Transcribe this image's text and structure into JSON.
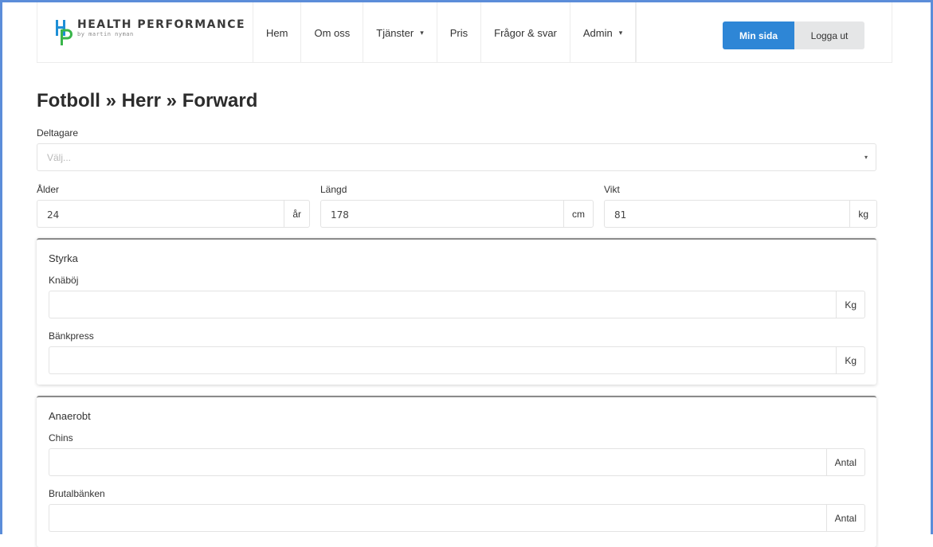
{
  "brand": {
    "title": "HEALTH PERFORMANCE",
    "subtitle": "by martin nyman",
    "colors": {
      "h": "#1e8fd6",
      "p": "#39b54a"
    }
  },
  "nav": {
    "items": [
      {
        "label": "Hem",
        "dropdown": false
      },
      {
        "label": "Om oss",
        "dropdown": false
      },
      {
        "label": "Tjänster",
        "dropdown": true
      },
      {
        "label": "Pris",
        "dropdown": false
      },
      {
        "label": "Frågor & svar",
        "dropdown": false
      },
      {
        "label": "Admin",
        "dropdown": true
      },
      {
        "label": "",
        "dropdown": false
      }
    ],
    "caret": "▾"
  },
  "auth": {
    "my_page": "Min sida",
    "logout": "Logga ut",
    "accent": "#2e86d6"
  },
  "page": {
    "title": "Fotboll » Herr » Forward"
  },
  "participant": {
    "label": "Deltagare",
    "placeholder": "Välj...",
    "value": ""
  },
  "fields": {
    "age": {
      "label": "Ålder",
      "value": "24",
      "unit": "år"
    },
    "height": {
      "label": "Längd",
      "value": "178",
      "unit": "cm"
    },
    "weight": {
      "label": "Vikt",
      "value": "81",
      "unit": "kg"
    }
  },
  "panels": {
    "strength": {
      "title": "Styrka",
      "items": [
        {
          "label": "Knäböj",
          "value": "",
          "unit": "Kg"
        },
        {
          "label": "Bänkpress",
          "value": "",
          "unit": "Kg"
        }
      ]
    },
    "anaerobic": {
      "title": "Anaerobt",
      "items": [
        {
          "label": "Chins",
          "value": "",
          "unit": "Antal"
        },
        {
          "label": "Brutalbänken",
          "value": "",
          "unit": "Antal"
        }
      ]
    }
  }
}
